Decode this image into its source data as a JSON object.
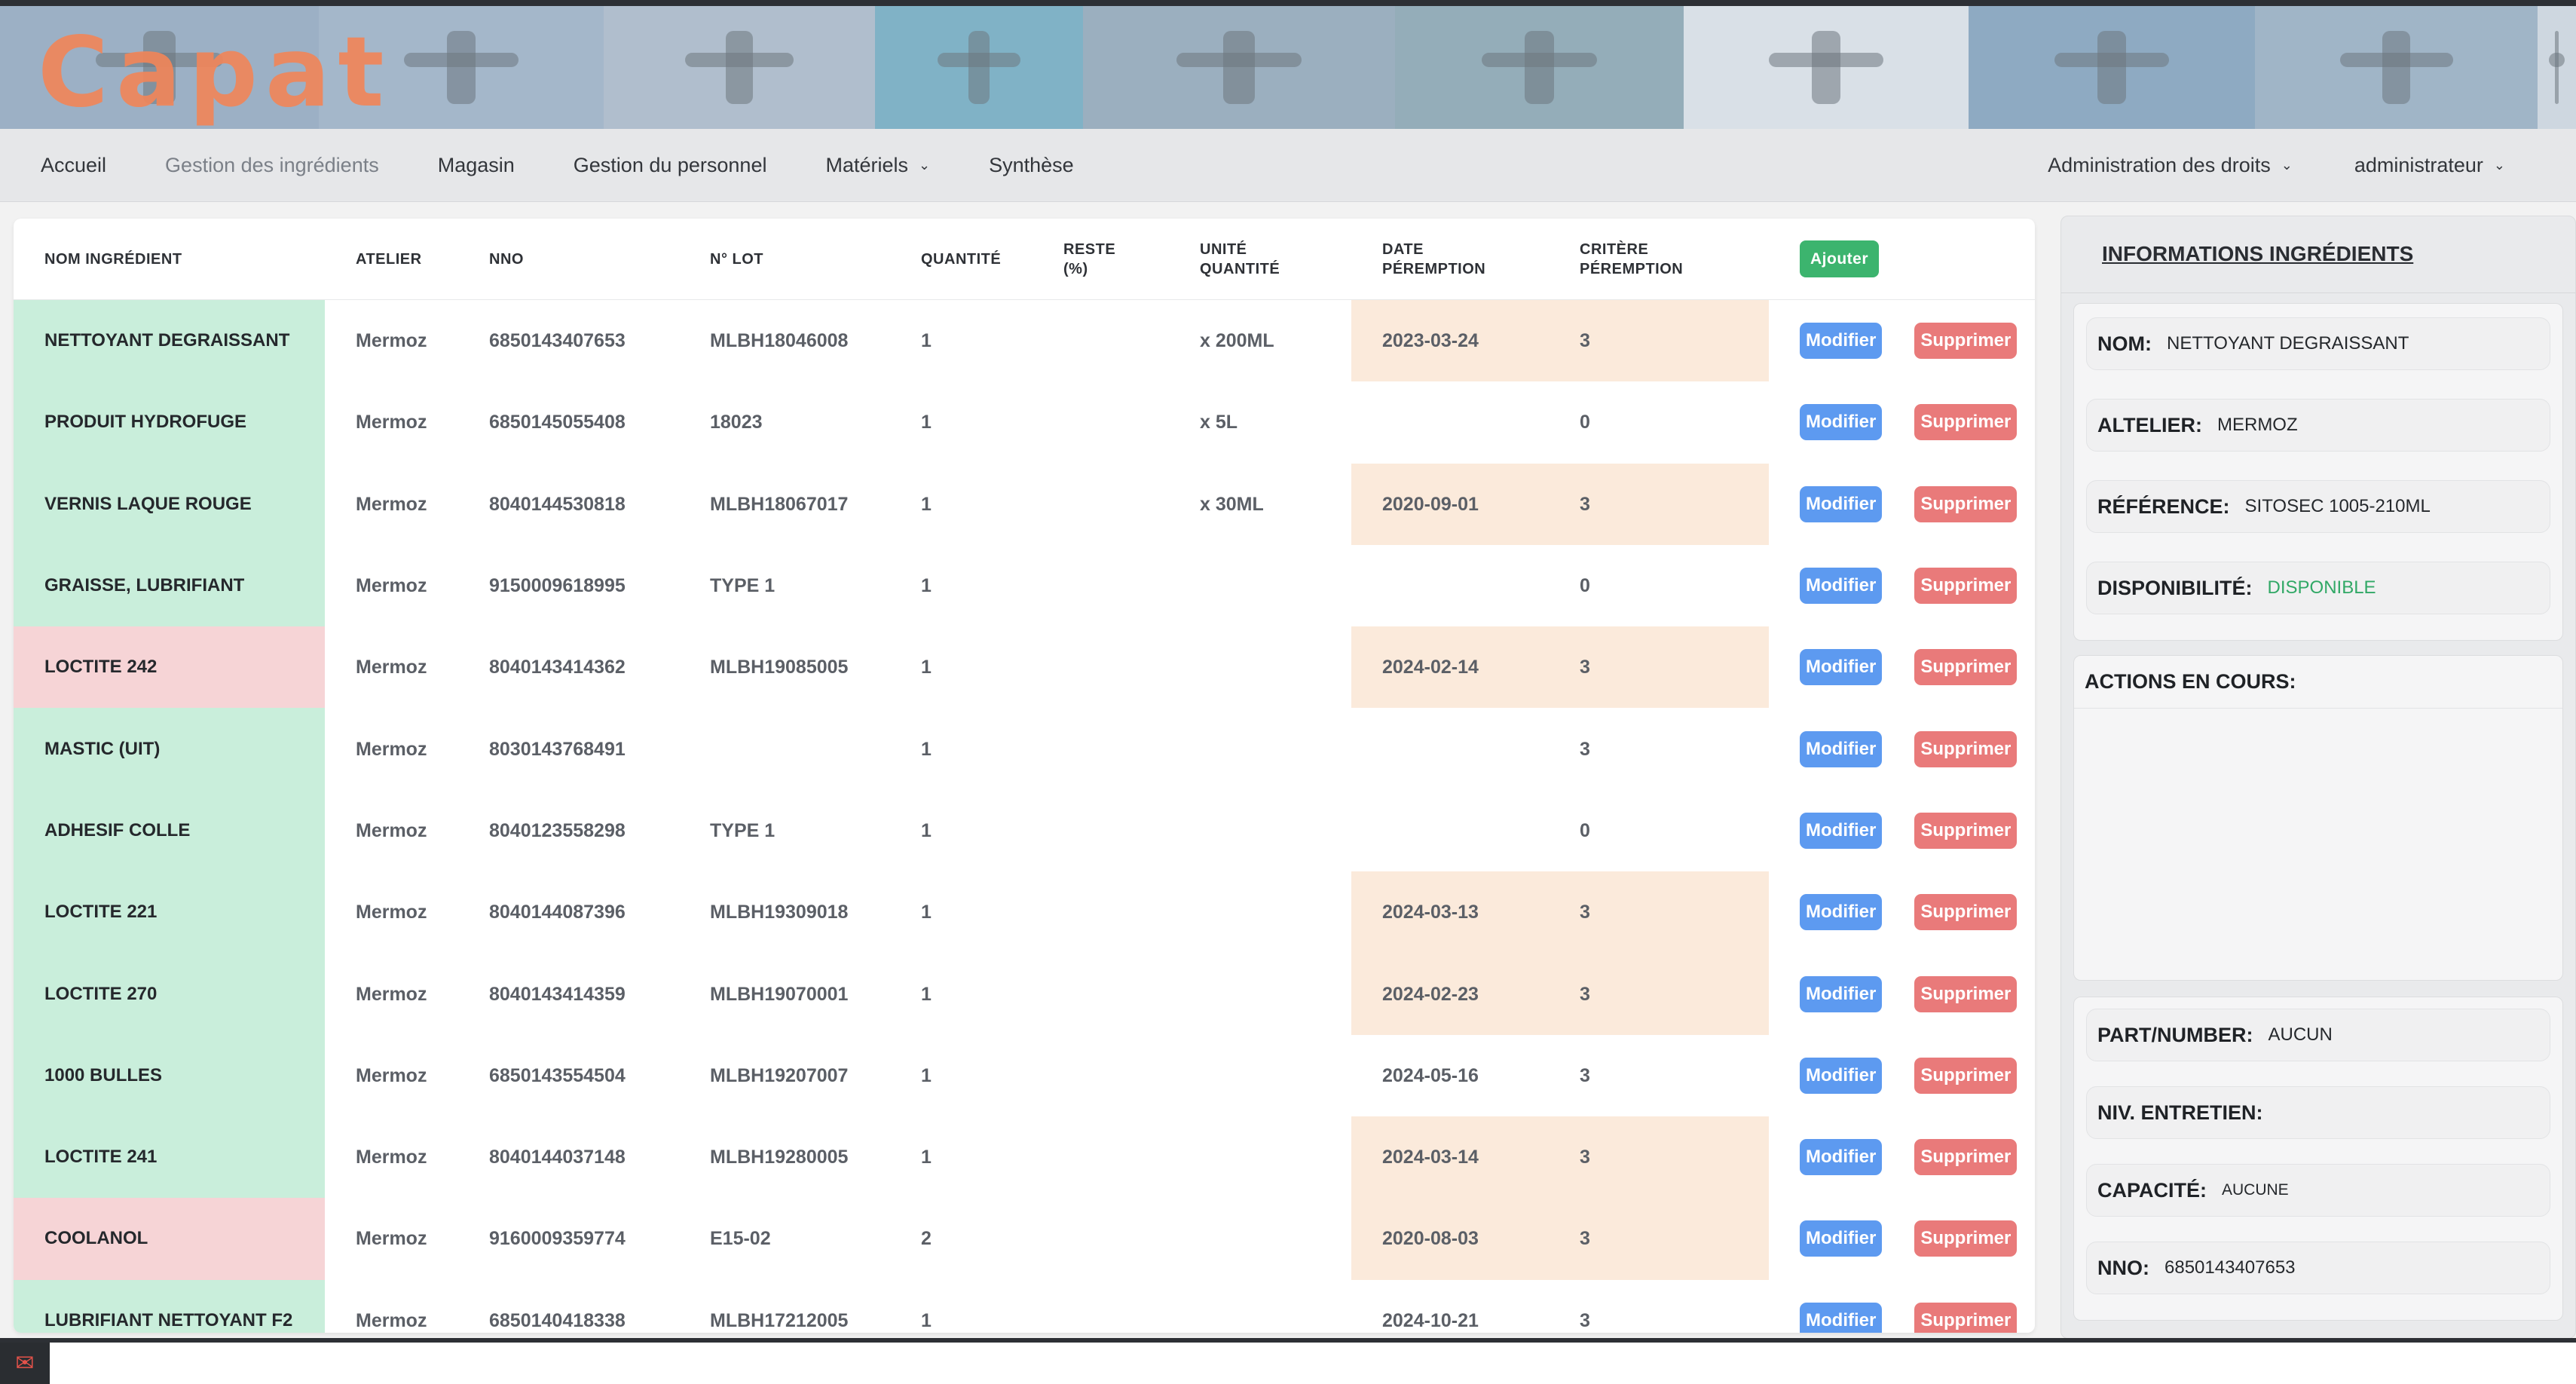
{
  "app": {
    "logo_text": "Capat"
  },
  "nav": {
    "left": [
      {
        "label": "Accueil",
        "active": false
      },
      {
        "label": "Gestion des ingrédients",
        "active": true
      },
      {
        "label": "Magasin",
        "active": false
      },
      {
        "label": "Gestion du personnel",
        "active": false
      },
      {
        "label": "Matériels",
        "dropdown": true
      },
      {
        "label": "Synthèse",
        "active": false
      }
    ],
    "admin_rights": "Administration des droits",
    "user": "administrateur"
  },
  "table": {
    "headers": {
      "name": "NOM INGRÉDIENT",
      "atelier": "ATELIER",
      "nno": "NNO",
      "lot": "N° LOT",
      "quantity": "QUANTITÉ",
      "reste": "RESTE (%)",
      "unit": "UNITÉ QUANTITÉ",
      "date": "DATE PÉREMPTION",
      "critere": "CRITÈRE PÉREMPTION"
    },
    "add_label": "Ajouter",
    "modify_label": "Modifier",
    "delete_label": "Supprimer",
    "rows": [
      {
        "name": "NETTOYANT DEGRAISSANT",
        "atelier": "Mermoz",
        "nno": "6850143407653",
        "lot": "MLBH18046008",
        "quantity": "1",
        "reste": "",
        "unit": "x 200ML",
        "date": "2023-03-24",
        "critere": "3",
        "status": "ok",
        "highlight": true
      },
      {
        "name": "PRODUIT HYDROFUGE",
        "atelier": "Mermoz",
        "nno": "6850145055408",
        "lot": "18023",
        "quantity": "1",
        "reste": "",
        "unit": "x 5L",
        "date": "",
        "critere": "0",
        "status": "ok",
        "highlight": false
      },
      {
        "name": "VERNIS LAQUE ROUGE",
        "atelier": "Mermoz",
        "nno": "8040144530818",
        "lot": "MLBH18067017",
        "quantity": "1",
        "reste": "",
        "unit": "x 30ML",
        "date": "2020-09-01",
        "critere": "3",
        "status": "ok",
        "highlight": true
      },
      {
        "name": "GRAISSE, LUBRIFIANT",
        "atelier": "Mermoz",
        "nno": "9150009618995",
        "lot": "TYPE 1",
        "quantity": "1",
        "reste": "",
        "unit": "",
        "date": "",
        "critere": "0",
        "status": "ok",
        "highlight": false
      },
      {
        "name": "LOCTITE 242",
        "atelier": "Mermoz",
        "nno": "8040143414362",
        "lot": "MLBH19085005",
        "quantity": "1",
        "reste": "",
        "unit": "",
        "date": "2024-02-14",
        "critere": "3",
        "status": "bad",
        "highlight": true
      },
      {
        "name": "MASTIC (UIT)",
        "atelier": "Mermoz",
        "nno": "8030143768491",
        "lot": "",
        "quantity": "1",
        "reste": "",
        "unit": "",
        "date": "",
        "critere": "3",
        "status": "ok",
        "highlight": false
      },
      {
        "name": "ADHESIF COLLE",
        "atelier": "Mermoz",
        "nno": "8040123558298",
        "lot": "TYPE 1",
        "quantity": "1",
        "reste": "",
        "unit": "",
        "date": "",
        "critere": "0",
        "status": "ok",
        "highlight": false
      },
      {
        "name": "LOCTITE 221",
        "atelier": "Mermoz",
        "nno": "8040144087396",
        "lot": "MLBH19309018",
        "quantity": "1",
        "reste": "",
        "unit": "",
        "date": "2024-03-13",
        "critere": "3",
        "status": "ok",
        "highlight": true
      },
      {
        "name": "LOCTITE 270",
        "atelier": "Mermoz",
        "nno": "8040143414359",
        "lot": "MLBH19070001",
        "quantity": "1",
        "reste": "",
        "unit": "",
        "date": "2024-02-23",
        "critere": "3",
        "status": "ok",
        "highlight": true
      },
      {
        "name": "1000 BULLES",
        "atelier": "Mermoz",
        "nno": "6850143554504",
        "lot": "MLBH19207007",
        "quantity": "1",
        "reste": "",
        "unit": "",
        "date": "2024-05-16",
        "critere": "3",
        "status": "ok",
        "highlight": false
      },
      {
        "name": "LOCTITE 241",
        "atelier": "Mermoz",
        "nno": "8040144037148",
        "lot": "MLBH19280005",
        "quantity": "1",
        "reste": "",
        "unit": "",
        "date": "2024-03-14",
        "critere": "3",
        "status": "ok",
        "highlight": true
      },
      {
        "name": "COOLANOL",
        "atelier": "Mermoz",
        "nno": "9160009359774",
        "lot": "E15-02",
        "quantity": "2",
        "reste": "",
        "unit": "",
        "date": "2020-08-03",
        "critere": "3",
        "status": "bad",
        "highlight": true
      },
      {
        "name": "LUBRIFIANT NETTOYANT F2",
        "atelier": "Mermoz",
        "nno": "6850140418338",
        "lot": "MLBH17212005",
        "quantity": "1",
        "reste": "",
        "unit": "",
        "date": "2024-10-21",
        "critere": "3",
        "status": "ok",
        "highlight": false
      }
    ]
  },
  "side": {
    "title": "INFORMATIONS INGRÉDIENTS",
    "nom_label": "NOM:",
    "nom_value": "NETTOYANT DEGRAISSANT",
    "atelier_label": "ALTELIER:",
    "atelier_value": "MERMOZ",
    "reference_label": "RÉFÉRENCE:",
    "reference_value": "SITOSEC 1005-210ML",
    "dispo_label": "DISPONIBILITÉ:",
    "dispo_value": "DISPONIBLE",
    "actions_label": "ACTIONS EN COURS:",
    "part_label": "PART/NUMBER:",
    "part_value": "AUCUN",
    "niv_label": "NIV. ENTRETIEN:",
    "niv_value": "",
    "capacite_label": "CAPACITÉ:",
    "capacite_value": "AUCUNE",
    "nno_label": "NNO:",
    "nno_value": "6850143407653"
  },
  "colors": {
    "ok_row": "#c9eedb",
    "bad_row": "#f6d4d6",
    "warn_cell": "#fbeadb",
    "modify_button": "#5d9af0",
    "delete_button": "#e97a7a",
    "add_button": "#3cb46e",
    "logo": "#f0865a"
  }
}
